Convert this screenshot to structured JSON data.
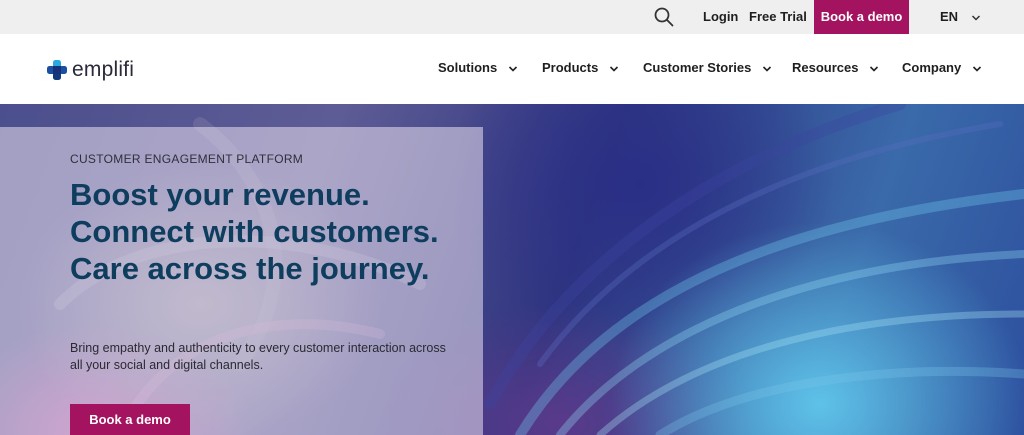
{
  "utility_bar": {
    "search_icon": "search-icon",
    "login": "Login",
    "free_trial": "Free Trial",
    "book_demo": "Book a demo",
    "language": "EN"
  },
  "brand": {
    "name": "emplifi",
    "accent": "#a3135f",
    "title_color": "#0e3d5e"
  },
  "nav": {
    "items": [
      {
        "label": "Solutions"
      },
      {
        "label": "Products"
      },
      {
        "label": "Customer Stories"
      },
      {
        "label": "Resources"
      },
      {
        "label": "Company"
      }
    ]
  },
  "hero": {
    "eyebrow": "CUSTOMER ENGAGEMENT PLATFORM",
    "title": "Boost your revenue. Connect with customers. Care across the journey.",
    "subtitle": "Bring empathy and authenticity to every customer interaction across all your social and digital channels.",
    "cta": "Book a demo"
  }
}
